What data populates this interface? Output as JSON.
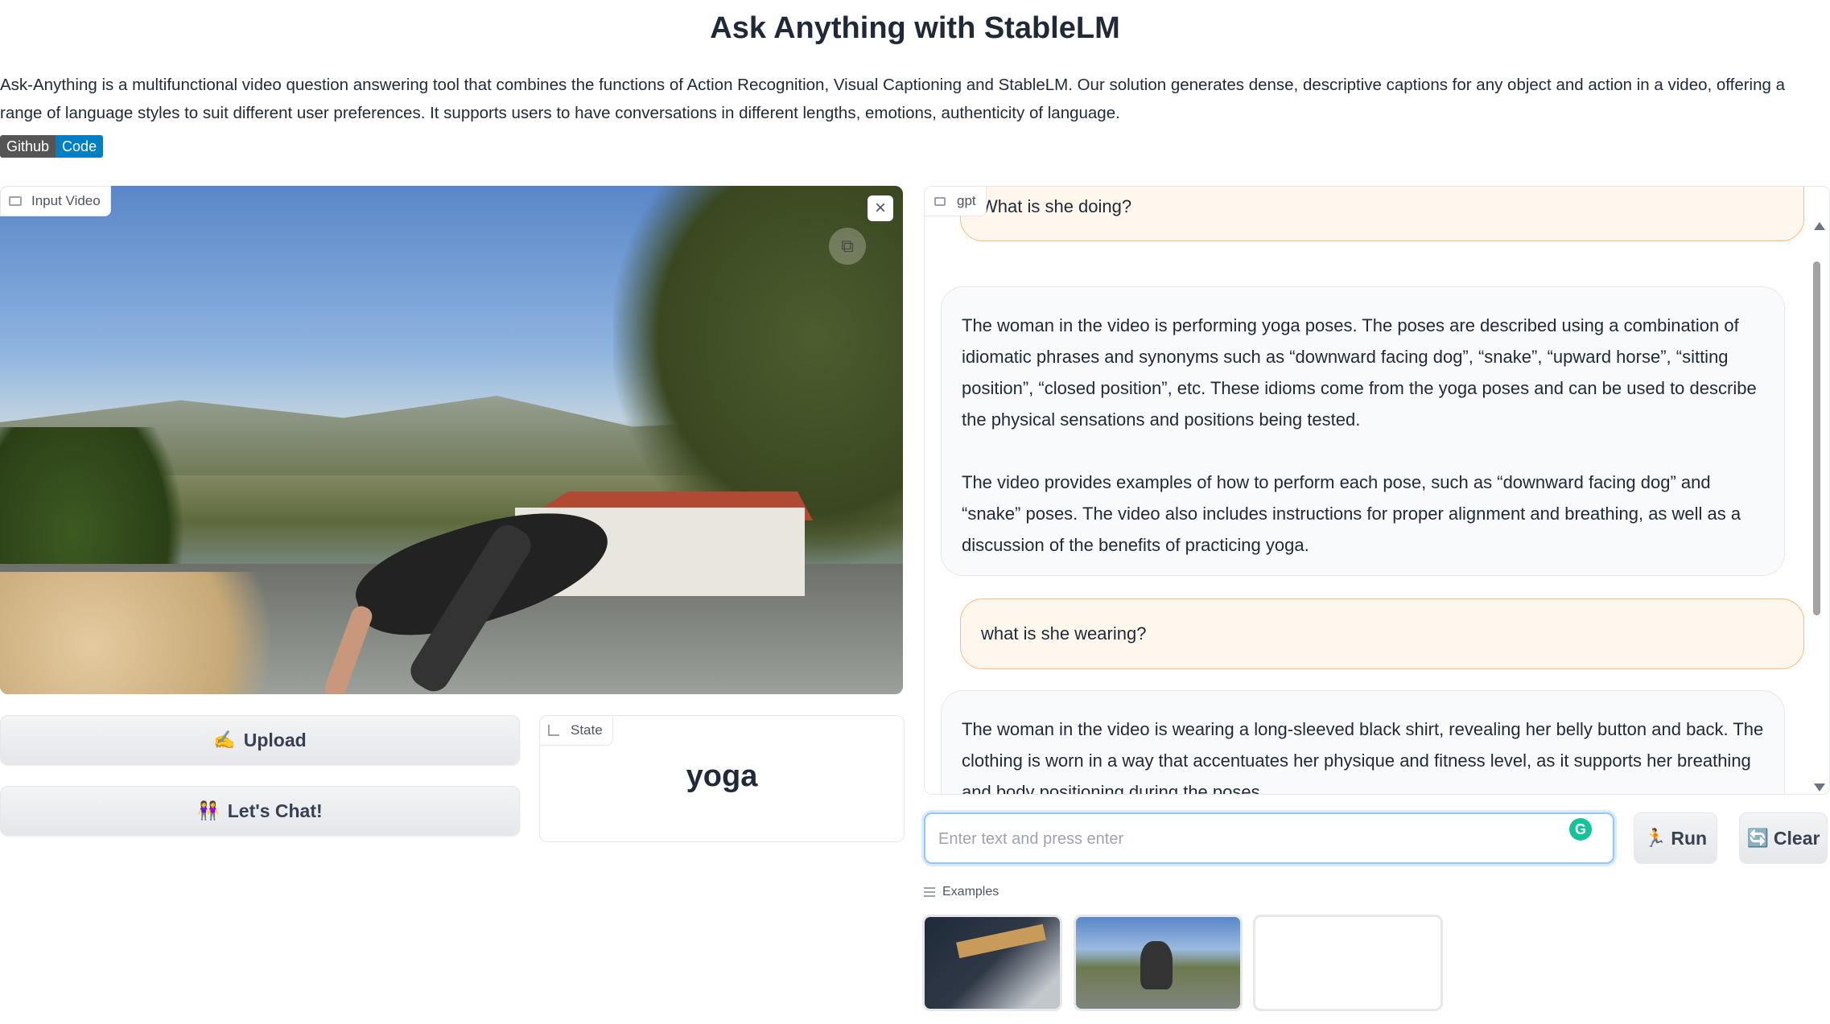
{
  "header": {
    "title": "Ask Anything with StableLM",
    "description": "Ask-Anything is a multifunctional video question answering tool that combines the functions of Action Recognition, Visual Captioning and StableLM. Our solution generates dense, descriptive captions for any object and action in a video, offering a range of language styles to suit different user preferences. It supports users to have conversations in different lengths, emotions, authenticity of language.",
    "badge_left": "Github",
    "badge_right": "Code"
  },
  "video": {
    "label": "Input Video",
    "close_icon": "×"
  },
  "buttons": {
    "upload_emoji": "✍️",
    "upload_label": "Upload",
    "chat_emoji": "👭",
    "chat_label": "Let's Chat!"
  },
  "state": {
    "label": "State",
    "value": "yoga"
  },
  "chat": {
    "label": "gpt",
    "messages": [
      {
        "role": "user",
        "text": "What is she doing?"
      },
      {
        "role": "bot",
        "text": "The woman in the video is performing yoga poses. The poses are described using a combination of idiomatic phrases and synonyms such as “downward facing dog”, “snake”, “upward horse”, “sitting position”, “closed position”, etc. These idioms come from the yoga poses and can be used to describe the physical sensations and positions being tested.",
        "text2": "The video provides examples of how to perform each pose, such as “downward facing dog” and “snake” poses. The video also includes instructions for proper alignment and breathing, as well as a discussion of the benefits of practicing yoga."
      },
      {
        "role": "user",
        "text": "what is she wearing?"
      },
      {
        "role": "bot",
        "text": "The woman in the video is wearing a long-sleeved black shirt, revealing her belly button and back. The clothing is worn in a way that accentuates her physique and fitness level, as it supports her breathing and body positioning during the poses."
      }
    ]
  },
  "input": {
    "placeholder": "Enter text and press enter",
    "value": ""
  },
  "actions": {
    "run_emoji": "🏃",
    "run_label": "Run",
    "clear_emoji": "🔄",
    "clear_label": "Clear"
  },
  "examples": {
    "label": "Examples"
  }
}
